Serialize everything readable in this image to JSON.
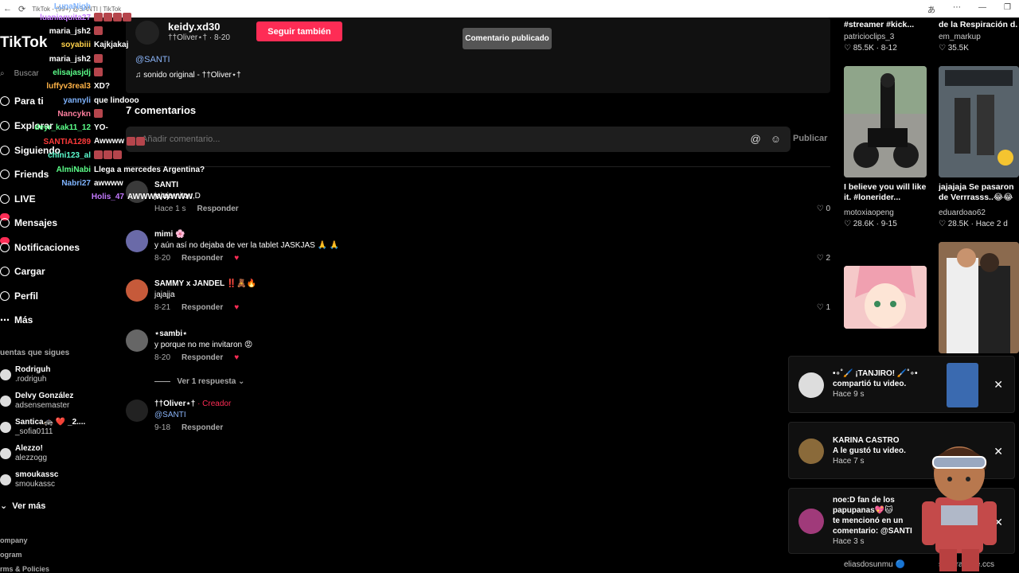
{
  "browser": {
    "tab_title": "TikTok - (99+) @SANTI | TikTok",
    "window_controls": [
      "あ",
      "⋯",
      "—",
      "❐"
    ]
  },
  "sidebar": {
    "logo": "TikTok",
    "search_placeholder": "Buscar",
    "nav": [
      {
        "label": "Para ti",
        "icon": "home-icon"
      },
      {
        "label": "Explorar",
        "icon": "compass-icon"
      },
      {
        "label": "Siguiendo",
        "icon": "following-icon"
      },
      {
        "label": "Friends",
        "icon": "friends-icon"
      },
      {
        "label": "LIVE",
        "icon": "live-icon"
      },
      {
        "label": "Mensajes",
        "icon": "message-icon"
      },
      {
        "label": "Notificaciones",
        "icon": "bell-icon"
      },
      {
        "label": "Cargar",
        "icon": "upload-icon"
      },
      {
        "label": "Perfil",
        "icon": "profile-icon"
      },
      {
        "label": "Más",
        "icon": "more-icon"
      }
    ],
    "following_title": "uentas que sigues",
    "following": [
      {
        "name": "Rodriguh",
        "handle": ".rodriguh"
      },
      {
        "name": "Delvy González",
        "handle": "adsensemaster"
      },
      {
        "name": "Santica🚓 ❤️ _2....",
        "handle": "_sofia0111"
      },
      {
        "name": "Alezzo!",
        "handle": "alezzogg"
      },
      {
        "name": "smoukassc",
        "handle": "smoukassc"
      }
    ],
    "see_more": "Ver más",
    "footer": [
      "ompany",
      "ogram",
      "rms & Policies"
    ]
  },
  "chat": [
    {
      "user": "LunaNigh",
      "msg": "",
      "color": "#7fb4ff"
    },
    {
      "user": "luaniaquita27",
      "msg": "",
      "color": "#c479ff"
    },
    {
      "user": "maria_jsh2",
      "msg": "",
      "color": "#ffffff"
    },
    {
      "user": "soyabiii",
      "msg": "Kajkjakaj",
      "color": "#ffd24a"
    },
    {
      "user": "maria_jsh2",
      "msg": "",
      "color": "#ffffff"
    },
    {
      "user": "elisajasjdj",
      "msg": "",
      "color": "#5cff8a"
    },
    {
      "user": "luffyv3real3",
      "msg": "XD?",
      "color": "#ffb347"
    },
    {
      "user": "yannyli",
      "msg": "que lindooo",
      "color": "#7fb4ff"
    },
    {
      "user": "Nancykn",
      "msg": "",
      "color": "#ff7f9f"
    },
    {
      "user": "deyr_kak11_12",
      "msg": "YO-",
      "color": "#5cff8a"
    },
    {
      "user": "SANTIA1289",
      "msg": "Awwww",
      "color": "#ff3b3b"
    },
    {
      "user": "chini123_al",
      "msg": "",
      "color": "#5cffd1"
    },
    {
      "user": "AlmiNabi",
      "msg": "Llega a mercedes Argentina?",
      "color": "#5cff8a"
    },
    {
      "user": "Nabri27",
      "msg": "awwww",
      "color": "#7fb4ff"
    },
    {
      "user": "Holis_47",
      "msg": "AWWWWWWWW",
      "color": "#c479ff"
    }
  ],
  "post": {
    "author": "keidy.xd30",
    "author_sub": "††Oliver⋆† · 8-20",
    "follow_label": "Seguir también",
    "toast": "Comentario publicado",
    "caption": "@SANTI",
    "sound": "♫ sonido original - ††Oliver⋆†"
  },
  "comments_section": {
    "count_label": "7 comentarios",
    "input_placeholder": "Añadir comentario...",
    "publish_label": "Publicar",
    "comments": [
      {
        "name": "SANTI",
        "text": "jajaja nito :,D",
        "date": "Hace 1 s",
        "reply": "Responder",
        "likes": "0",
        "avatar_color": "#3a3a3a"
      },
      {
        "name": "mimi 🌸",
        "text": "y aún así no dejaba de ver la tablet JASKJAS 🙏 🙏",
        "date": "8-20",
        "reply": "Responder",
        "likes": "2",
        "avatar_color": "#6a6aa8"
      },
      {
        "name": "SAMMY x JANDEL ‼️🧸🔥",
        "text": "jajajja",
        "date": "8-21",
        "reply": "Responder",
        "likes": "1",
        "avatar_color": "#c65a3a"
      },
      {
        "name": "⋆sambi⋆",
        "text": "y porque no me invitaron 😡",
        "date": "8-20",
        "reply": "Responder",
        "likes": "",
        "avatar_color": "#666"
      },
      {
        "name": "††Oliver⋆†",
        "creator": "· Creador",
        "text": "@SANTI",
        "date": "9-18",
        "reply": "Responder",
        "likes": "",
        "avatar_color": "#222"
      }
    ],
    "view_replies": "Ver 1 respuesta ⌄"
  },
  "videos": [
    {
      "title": "#streamer #kick...",
      "author": "patricioclips_3",
      "stats": "♡ 85.5K · 8-12"
    },
    {
      "title": "de la Respiración d...",
      "author": "em_markup",
      "stats": "♡ 35.5K"
    },
    {
      "title": "I believe you will like it. #lonerider...",
      "author": "motoxiaopeng",
      "stats": "♡ 28.6K · 9-15"
    },
    {
      "title": "jajajaja Se pasaron de Verrrasss..😂😂",
      "author": "eduardoao62",
      "stats": "♡ 28.5K · Hace 2 d"
    },
    {
      "title": "",
      "author": "eliasdosunmu 🔵",
      "stats": ""
    },
    {
      "title": "",
      "author": "superanime.ccs",
      "stats": ""
    }
  ],
  "notifications": [
    {
      "text1": "•∘˚🖌️ ¡TANJIRO! 🖌️˚∘•",
      "text2": "compartió tu video.",
      "time": "Hace 9 s"
    },
    {
      "text1": "KARINA CASTRO",
      "text2": "A le gustó tu video.",
      "time": "Hace 7 s"
    },
    {
      "text1": "noe:D fan de los papupanas💖🐱",
      "text2": "te mencionó en un comentario: @SANTI",
      "time": "Hace 3 s"
    }
  ],
  "colors": {
    "accent": "#fe2c55",
    "link": "#8ab4f8",
    "background": "#000000"
  }
}
